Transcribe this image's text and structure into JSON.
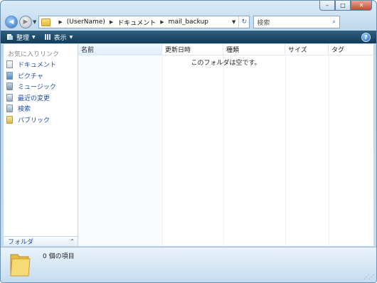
{
  "window": {
    "controls": {
      "minimize": "–",
      "maximize": "□",
      "close": "✕"
    }
  },
  "address": {
    "breadcrumbs": [
      "(UserName)",
      "ドキュメント",
      "mail_backup"
    ]
  },
  "search": {
    "placeholder": "検索"
  },
  "toolbar": {
    "organize": "整理",
    "views": "表示",
    "help": "?"
  },
  "nav": {
    "favorites_title": "お気に入りリンク",
    "items": [
      {
        "label": "ドキュメント",
        "icon": "documents-icon"
      },
      {
        "label": "ピクチャ",
        "icon": "pictures-icon"
      },
      {
        "label": "ミュージック",
        "icon": "music-icon"
      },
      {
        "label": "最近の変更",
        "icon": "recent-changes-icon"
      },
      {
        "label": "検索",
        "icon": "searches-icon"
      },
      {
        "label": "パブリック",
        "icon": "public-folder-icon"
      }
    ],
    "folders_label": "フォルダ"
  },
  "list": {
    "columns": [
      "名前",
      "更新日時",
      "種類",
      "サイズ",
      "タグ"
    ],
    "empty_message": "このフォルダは空です。"
  },
  "details": {
    "count": "0 個の項目"
  },
  "colors": {
    "toolbar": "#1b4a68",
    "link": "#1f4ea0",
    "accent": "#2f72c4"
  }
}
